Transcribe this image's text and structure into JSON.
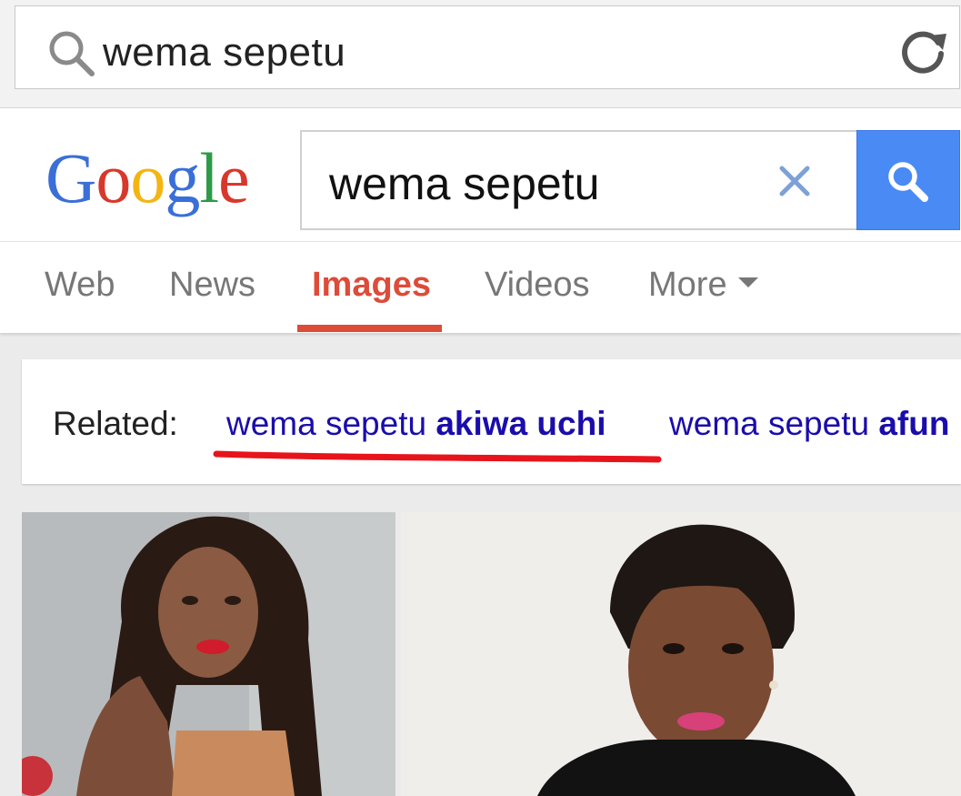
{
  "browser": {
    "address_text": "wema sepetu"
  },
  "google": {
    "logo_letters": [
      {
        "char": "G",
        "color": "#3a6fd8"
      },
      {
        "char": "o",
        "color": "#d7382b"
      },
      {
        "char": "o",
        "color": "#f3b511"
      },
      {
        "char": "g",
        "color": "#3a6fd8"
      },
      {
        "char": "l",
        "color": "#2d9a47"
      },
      {
        "char": "e",
        "color": "#d7382b"
      }
    ],
    "query": "wema sepetu"
  },
  "tabs": {
    "web": "Web",
    "news": "News",
    "images": "Images",
    "videos": "Videos",
    "more": "More"
  },
  "related": {
    "label": "Related:",
    "items": [
      {
        "prefix": "wema sepetu ",
        "bold": "akiwa uchi"
      },
      {
        "prefix": "wema sepetu ",
        "bold": "afun"
      }
    ]
  },
  "colors": {
    "accent_red": "#dd4b39",
    "link_blue": "#1a0dab",
    "search_button_blue": "#4a8af4",
    "annotation_red": "#e8141b"
  },
  "icons": {
    "address_search": "search-icon",
    "address_reload": "reload-icon",
    "query_clear": "close-icon",
    "query_submit": "search-icon"
  }
}
